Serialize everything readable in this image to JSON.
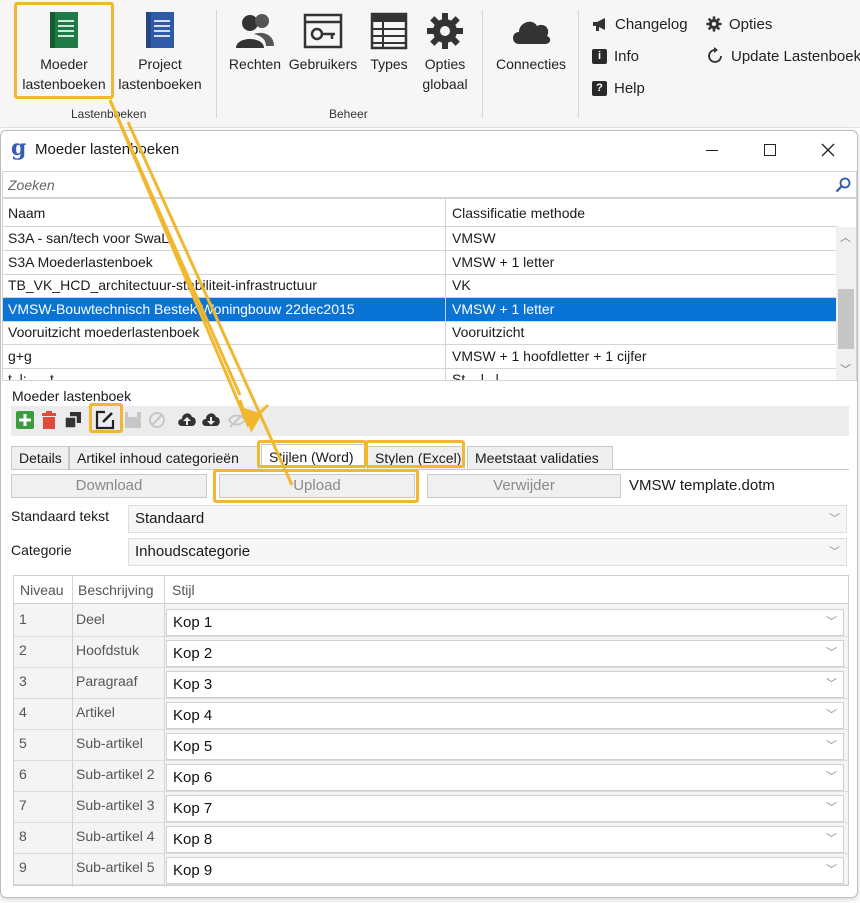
{
  "ribbon": {
    "groups": [
      {
        "label": "Lastenboeken",
        "buttons": [
          "Moeder lastenboeken",
          "Project lastenboeken"
        ]
      },
      {
        "label": "Beheer",
        "buttons": [
          "Rechten",
          "Gebruikers",
          "Types",
          "Opties globaal"
        ]
      },
      {
        "label": "",
        "buttons": [
          "Connecties"
        ]
      }
    ],
    "labels": {
      "moeder": [
        "Moeder",
        "lastenboeken"
      ],
      "project": [
        "Project",
        "lastenboeken"
      ],
      "rechten": "Rechten",
      "gebruikers": "Gebruikers",
      "types": "Types",
      "opties_globaal": [
        "Opties",
        "globaal"
      ],
      "connecties": "Connecties",
      "group_lastenboeken": "Lastenboeken",
      "group_beheer": "Beheer"
    },
    "small_buttons": {
      "changelog": "Changelog",
      "info": "Info",
      "help": "Help",
      "opties": "Opties",
      "update": "Update Lastenboek"
    },
    "colors": {
      "highlight": "#f1b82f",
      "green_book": "#1e7b45",
      "blue_book": "#2f5aa8"
    }
  },
  "window": {
    "title": "Moeder lastenboeken",
    "app_icon": "g",
    "search_placeholder": "Zoeken",
    "columns": [
      "Naam",
      "Classificatie methode"
    ],
    "rows": [
      {
        "naam": "S3A - san/tech voor SwaL",
        "methode": "VMSW"
      },
      {
        "naam": "S3A Moederlastenboek",
        "methode": "VMSW + 1 letter"
      },
      {
        "naam": "TB_VK_HCD_architectuur-stabiliteit-infrastructuur",
        "methode": "VK"
      },
      {
        "naam": "VMSW-Bouwtechnisch Bestek Woningbouw 22dec2015",
        "methode": "VMSW + 1 letter",
        "selected": true
      },
      {
        "naam": "Vooruitzicht moederlastenboek",
        "methode": "Vooruitzicht"
      },
      {
        "naam": "g+g",
        "methode": "VMSW + 1 hoofdletter + 1 cijfer"
      },
      {
        "naam": "t .l: .....t",
        "methode": "St....l...l"
      }
    ],
    "selection_color": "#0a74d6"
  },
  "detail": {
    "title": "Moeder lastenboek",
    "tabs": [
      "Details",
      "Artikel inhoud categorieën",
      "Stijlen (Word)",
      "Stylen (Excel)",
      "Meetstaat validaties"
    ],
    "active_tab": "Stijlen (Word)",
    "buttons": {
      "download": "Download",
      "upload": "Upload",
      "verwijder": "Verwijder"
    },
    "template_file": "VMSW template.dotm",
    "standaard_tekst_label": "Standaard tekst",
    "standaard_tekst_value": "Standaard",
    "categorie_label": "Categorie",
    "categorie_value": "Inhoudscategorie",
    "level_columns": [
      "Niveau",
      "Beschrijving",
      "Stijl"
    ],
    "levels": [
      {
        "niveau": "1",
        "beschrijving": "Deel",
        "stijl": "Kop 1"
      },
      {
        "niveau": "2",
        "beschrijving": "Hoofdstuk",
        "stijl": "Kop 2"
      },
      {
        "niveau": "3",
        "beschrijving": "Paragraaf",
        "stijl": "Kop 3"
      },
      {
        "niveau": "4",
        "beschrijving": "Artikel",
        "stijl": "Kop 4"
      },
      {
        "niveau": "5",
        "beschrijving": "Sub-artikel",
        "stijl": "Kop 5"
      },
      {
        "niveau": "6",
        "beschrijving": "Sub-artikel 2",
        "stijl": "Kop 6"
      },
      {
        "niveau": "7",
        "beschrijving": "Sub-artikel 3",
        "stijl": "Kop 7"
      },
      {
        "niveau": "8",
        "beschrijving": "Sub-artikel 4",
        "stijl": "Kop 8"
      },
      {
        "niveau": "9",
        "beschrijving": "Sub-artikel 5",
        "stijl": "Kop 9"
      }
    ]
  }
}
